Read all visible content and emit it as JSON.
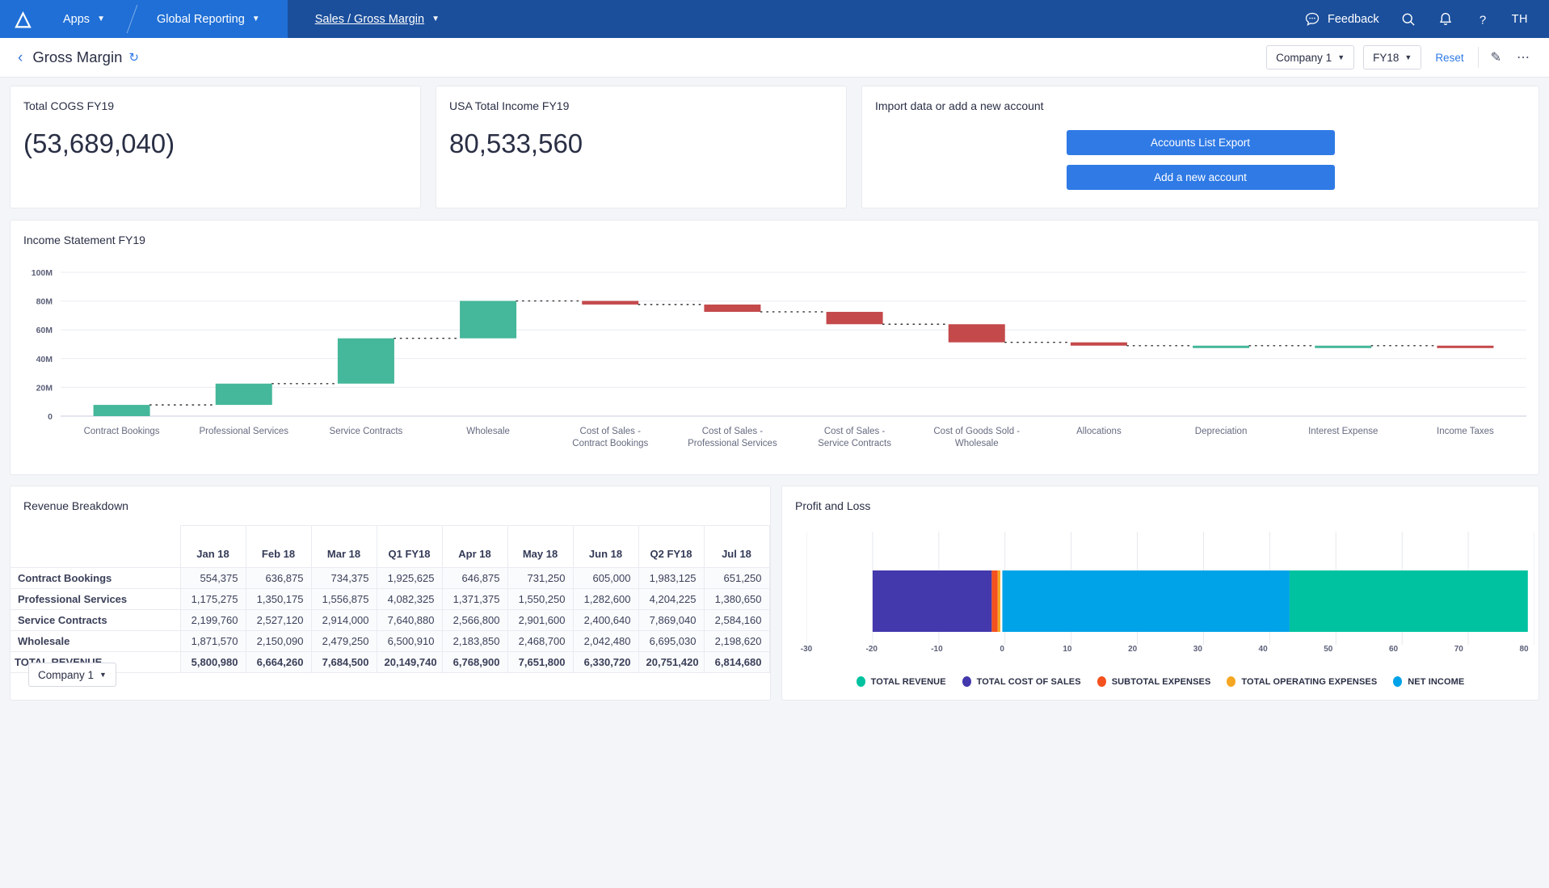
{
  "topnav": {
    "logo": "logo-glyph",
    "items": [
      {
        "label": "Apps"
      },
      {
        "label": "Global Reporting"
      },
      {
        "label": "Sales / Gross Margin"
      }
    ],
    "feedback_label": "Feedback",
    "avatar_initials": "TH",
    "brand_blue": "#1f6fd6",
    "brand_dark_blue": "#1b4f9c"
  },
  "subheader": {
    "title": "Gross Margin",
    "company_filter": "Company 1",
    "year_filter": "FY18",
    "reset_label": "Reset"
  },
  "kpis": [
    {
      "title": "Total COGS FY19",
      "value": "(53,689,040)"
    },
    {
      "title": "USA Total Income FY19",
      "value": "80,533,560"
    }
  ],
  "import_card": {
    "title": "Import data or add a new account",
    "buttons": [
      {
        "label": "Accounts List Export"
      },
      {
        "label": "Add a new account"
      }
    ]
  },
  "chart_data": [
    {
      "type": "bar",
      "chart_name": "waterfall",
      "title": "Income Statement FY19",
      "xlabel": "",
      "ylabel": "",
      "ylim": [
        0,
        100
      ],
      "yticks": [
        0,
        20,
        40,
        60,
        80,
        100
      ],
      "ytick_labels": [
        "0",
        "20M",
        "40M",
        "60M",
        "80M",
        "100M"
      ],
      "grid": true,
      "units": "millions",
      "positive_color": "#45b79a",
      "negative_color": "#c4494b",
      "categories": [
        "Contract Bookings",
        "Professional Services",
        "Service Contracts",
        "Wholesale",
        "Cost of Sales - Contract Bookings",
        "Cost of Sales - Professional Services",
        "Cost of Sales - Service Contracts",
        "Cost of Goods Sold - Wholesale",
        "Allocations",
        "Depreciation",
        "Interest Expense",
        "Income Taxes"
      ],
      "deltas": [
        7.8,
        14.8,
        31.5,
        26.0,
        -2.5,
        -5.1,
        -8.6,
        -12.6,
        -2.3,
        0.0,
        0.0,
        -0.3
      ],
      "starts": [
        0.0,
        7.8,
        22.6,
        54.1,
        80.1,
        77.6,
        72.5,
        63.9,
        51.3,
        49.0,
        49.0,
        49.0
      ],
      "ends": [
        7.8,
        22.6,
        54.1,
        80.1,
        77.6,
        72.5,
        63.9,
        51.3,
        49.0,
        49.0,
        49.0,
        48.7
      ]
    },
    {
      "type": "bar",
      "chart_name": "profit-and-loss",
      "title": "Profit and Loss",
      "orientation": "horizontal-stacked",
      "xlim": [
        -30,
        80
      ],
      "xticks": [
        -30,
        -20,
        -10,
        0,
        10,
        20,
        30,
        40,
        50,
        60,
        70,
        80
      ],
      "xtick_labels": [
        "-30",
        "-20",
        "-10",
        "0",
        "10",
        "20",
        "30",
        "40",
        "50",
        "60",
        "70",
        "80"
      ],
      "grid": true,
      "legend_position": "bottom",
      "series": [
        {
          "name": "TOTAL COST OF SALES",
          "color": "#4338ac",
          "start": -20.0,
          "end": -2.0
        },
        {
          "name": "SUBTOTAL EXPENSES",
          "color": "#f4511e",
          "start": -2.0,
          "end": -1.1
        },
        {
          "name": "TOTAL OPERATING EXPENSES",
          "color": "#f5a623",
          "start": -1.1,
          "end": -0.7
        },
        {
          "name": "NET INCOME",
          "color": "#00a3e8",
          "start": -0.4,
          "end": 43.0
        },
        {
          "name": "TOTAL REVENUE",
          "color": "#00c2a0",
          "start": 43.0,
          "end": 79.0
        }
      ],
      "legend": [
        {
          "label": "TOTAL REVENUE",
          "color": "#00c2a0"
        },
        {
          "label": "TOTAL COST OF SALES",
          "color": "#4338ac"
        },
        {
          "label": "SUBTOTAL EXPENSES",
          "color": "#f4511e"
        },
        {
          "label": "TOTAL OPERATING EXPENSES",
          "color": "#f5a623"
        },
        {
          "label": "NET INCOME",
          "color": "#00a3e8"
        }
      ]
    }
  ],
  "revenue_table": {
    "title": "Revenue Breakdown",
    "company_filter": "Company 1",
    "columns": [
      "",
      "Jan 18",
      "Feb 18",
      "Mar 18",
      "Q1 FY18",
      "Apr 18",
      "May 18",
      "Jun 18",
      "Q2 FY18",
      "Jul 18",
      ""
    ],
    "rows": [
      {
        "label": "Contract Bookings",
        "values": [
          "554,375",
          "636,875",
          "734,375",
          "1,925,625",
          "646,875",
          "731,250",
          "605,000",
          "1,983,125",
          "651,250",
          ""
        ]
      },
      {
        "label": "Professional Services",
        "values": [
          "1,175,275",
          "1,350,175",
          "1,556,875",
          "4,082,325",
          "1,371,375",
          "1,550,250",
          "1,282,600",
          "4,204,225",
          "1,380,650",
          ""
        ]
      },
      {
        "label": "Service Contracts",
        "values": [
          "2,199,760",
          "2,527,120",
          "2,914,000",
          "7,640,880",
          "2,566,800",
          "2,901,600",
          "2,400,640",
          "7,869,040",
          "2,584,160",
          ""
        ]
      },
      {
        "label": "Wholesale",
        "values": [
          "1,871,570",
          "2,150,090",
          "2,479,250",
          "6,500,910",
          "2,183,850",
          "2,468,700",
          "2,042,480",
          "6,695,030",
          "2,198,620",
          ""
        ]
      }
    ],
    "total_row": {
      "label": "TOTAL REVENUE",
      "values": [
        "5,800,980",
        "6,664,260",
        "7,684,500",
        "20,149,740",
        "6,768,900",
        "7,651,800",
        "6,330,720",
        "20,751,420",
        "6,814,680",
        ""
      ]
    }
  }
}
